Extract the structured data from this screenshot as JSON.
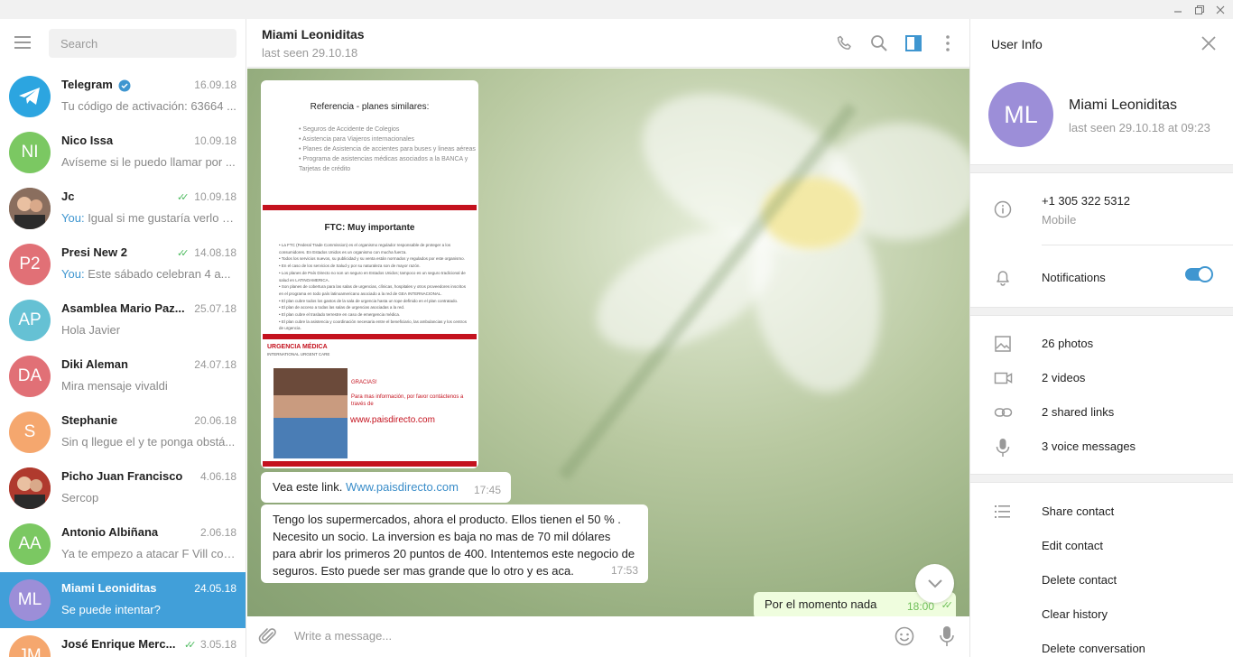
{
  "search": {
    "placeholder": "Search"
  },
  "chats": [
    {
      "name": "Telegram",
      "verified": true,
      "date": "16.09.18",
      "msg": "Tu código de activación: 63664 ...",
      "you": false,
      "read": false,
      "avatar": {
        "initials": "",
        "color": "#2ca5e0",
        "icon": "telegram-icon"
      }
    },
    {
      "name": "Nico Issa",
      "date": "10.09.18",
      "msg": "Avíseme si le puedo llamar por ...",
      "you": false,
      "read": false,
      "avatar": {
        "initials": "NI",
        "color": "#7bc862"
      }
    },
    {
      "name": "Jc",
      "date": "10.09.18",
      "msg": "Igual si me gustaría verlo s...",
      "you": true,
      "read": true,
      "avatar": {
        "initials": "",
        "color": "#8a6e5e",
        "icon": "photo-avatar"
      }
    },
    {
      "name": "Presi New 2",
      "date": "14.08.18",
      "msg": "Este sábado celebran 4 a...",
      "you": true,
      "read": true,
      "avatar": {
        "initials": "P2",
        "color": "#e17076"
      }
    },
    {
      "name": "Asamblea Mario Paz...",
      "date": "25.07.18",
      "msg": "Hola Javier",
      "you": false,
      "read": false,
      "avatar": {
        "initials": "AP",
        "color": "#65c1d4"
      }
    },
    {
      "name": "Diki Aleman",
      "date": "24.07.18",
      "msg": "Mira mensaje vivaldi",
      "you": false,
      "read": false,
      "avatar": {
        "initials": "DA",
        "color": "#e17076"
      }
    },
    {
      "name": "Stephanie",
      "date": "20.06.18",
      "msg": "Sin q llegue el y te ponga obstá...",
      "you": false,
      "read": false,
      "avatar": {
        "initials": "S",
        "color": "#f5a76e"
      }
    },
    {
      "name": "Picho Juan Francisco",
      "date": "4.06.18",
      "msg": "Sercop",
      "you": false,
      "read": false,
      "avatar": {
        "initials": "",
        "color": "#b03a2e",
        "icon": "photo-avatar"
      }
    },
    {
      "name": "Antonio Albiñana",
      "date": "2.06.18",
      "msg": "Ya te empezo a atacar F Vill con...",
      "you": false,
      "read": false,
      "avatar": {
        "initials": "AA",
        "color": "#7bc862"
      }
    },
    {
      "name": "Miami Leoniditas",
      "date": "24.05.18",
      "msg": "Se puede intentar?",
      "you": false,
      "read": false,
      "active": true,
      "avatar": {
        "initials": "ML",
        "color": "#9c8ed8"
      }
    },
    {
      "name": "José Enrique Merc...",
      "date": "3.05.18",
      "msg": "",
      "you": false,
      "read": true,
      "avatar": {
        "initials": "JM",
        "color": "#f5a76e"
      }
    }
  ],
  "you_label": "You:",
  "chat": {
    "title": "Miami Leoniditas",
    "status": "last seen 29.10.18",
    "slide1": {
      "title": "Referencia - planes similares:",
      "items": [
        "Seguros de Accidente de Colegios",
        "Asistencia para Viajeros internacionales",
        "Planes de Asistencia de accientes para buses y lineas aéreas",
        "Programa de asistencias médicas asociados a la BANCA y Tarjetas de crédito"
      ]
    },
    "slide2": {
      "title": "FTC: Muy importante",
      "items": [
        "La FTC (Federal Trade Commission) es el organismo regulador responsable de proteger a los consumidores. En Estados Unidos es un organismo con mucha fuerza.",
        "Todos los servicios nuevos, su publicidad y su venta están normados y regulados por este organismo.",
        "En el caso de los servicios de Salud y por su naturaleza son de mayor razón.",
        "Los planes de País Directo no son un seguro en Estados Unidos; tampoco es un seguro tradicional de salud en LATINOAMERICA.",
        "Son planes de cobertura para las salas de urgencias, clínicas, hospitales y otros proveedores inscritos en el programa en todo país latinoamericano asociado a la red de GEA INTERNACIONAL.",
        "El plan cubre todos los gastos de la sala de urgencia hasta un tope definido en el plan contratado.",
        "El plan de acceso a todas las salas de urgencias asociadas a la red.",
        "El plan cubre el traslado terrestre en caso de emergencia médica.",
        "El plan cubre la asistencia y coordinación necesaria entre el beneficiario, las ambulancias y los centros de urgencia."
      ]
    },
    "slide3": {
      "logo": "URGENCIA MÉDICA",
      "logo_sub": "INTERNATIONAL URGENT CARE",
      "thanks": "GRACIAS!",
      "info": "Para mas información, por favor contáctenos a través de",
      "url": "www.paisdirecto.com"
    },
    "messages": [
      {
        "text": "Vea este link. ",
        "link": "Www.paisdirecto.com",
        "time": "17:45"
      },
      {
        "text": "Tengo los supermercados, ahora el producto. Ellos tienen el 50 % . Necesito un socio. La inversion es baja no mas de 70 mil dólares para abrir los primeros 20 puntos de 400.  Intentemos este negocio de seguros. Esto puede ser mas grande que lo otro y es aca.",
        "time": "17:53"
      },
      {
        "text": "Por el momento  nada",
        "time": "18:00",
        "outgoing": true
      }
    ],
    "compose_placeholder": "Write a message..."
  },
  "user_info": {
    "title": "User Info",
    "initials": "ML",
    "name": "Miami Leoniditas",
    "seen": "last seen 29.10.18 at 09:23",
    "phone": "+1 305 322 5312",
    "phone_label": "Mobile",
    "notifications": "Notifications",
    "notifications_on": true,
    "media": {
      "photos": "26 photos",
      "videos": "2 videos",
      "links": "2 shared links",
      "voice": "3 voice messages"
    },
    "actions": {
      "share": "Share contact",
      "edit": "Edit contact",
      "delete": "Delete contact",
      "clear": "Clear history",
      "delete_conv": "Delete conversation"
    }
  }
}
